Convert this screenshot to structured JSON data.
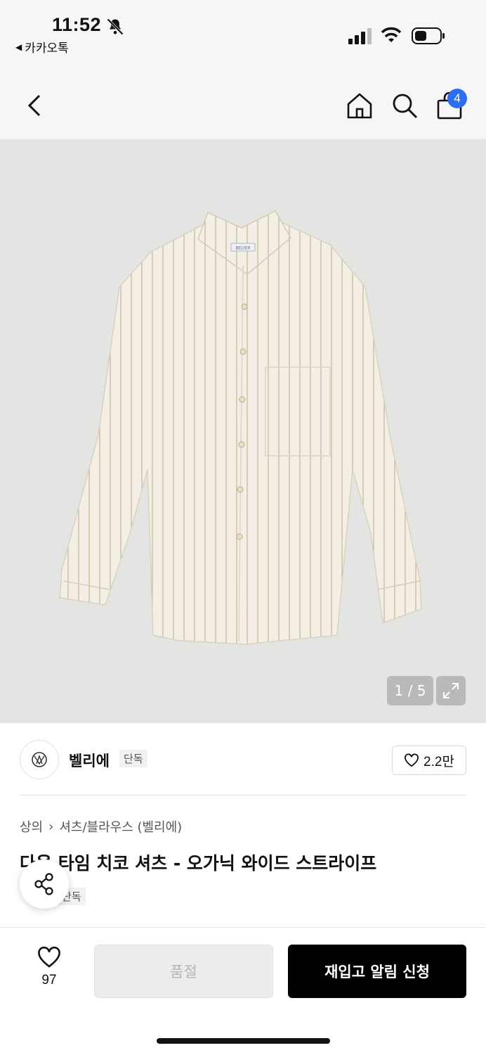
{
  "status": {
    "time": "11:52",
    "back_app": "카카오톡"
  },
  "nav": {
    "cart_badge": "4"
  },
  "gallery": {
    "counter": "1 / 5",
    "shirt_tag": "BELIER"
  },
  "brand": {
    "name": "벨리에",
    "tag": "단독",
    "likes": "2.2만"
  },
  "breadcrumb": {
    "level1": "상의",
    "level2": "셔츠/블라우스 (벨리에)"
  },
  "product": {
    "title": "다음 타임 치코 셔츠 - 오가닉 와이드 스트라이프",
    "tag": "단독"
  },
  "bottom": {
    "wish_count": "97",
    "soldout_label": "품절",
    "restock_label": "재입고 알림 신청"
  },
  "colors": {
    "accent_badge": "#2c6df2",
    "primary_button": "#000000",
    "disabled_button": "#ececec"
  }
}
